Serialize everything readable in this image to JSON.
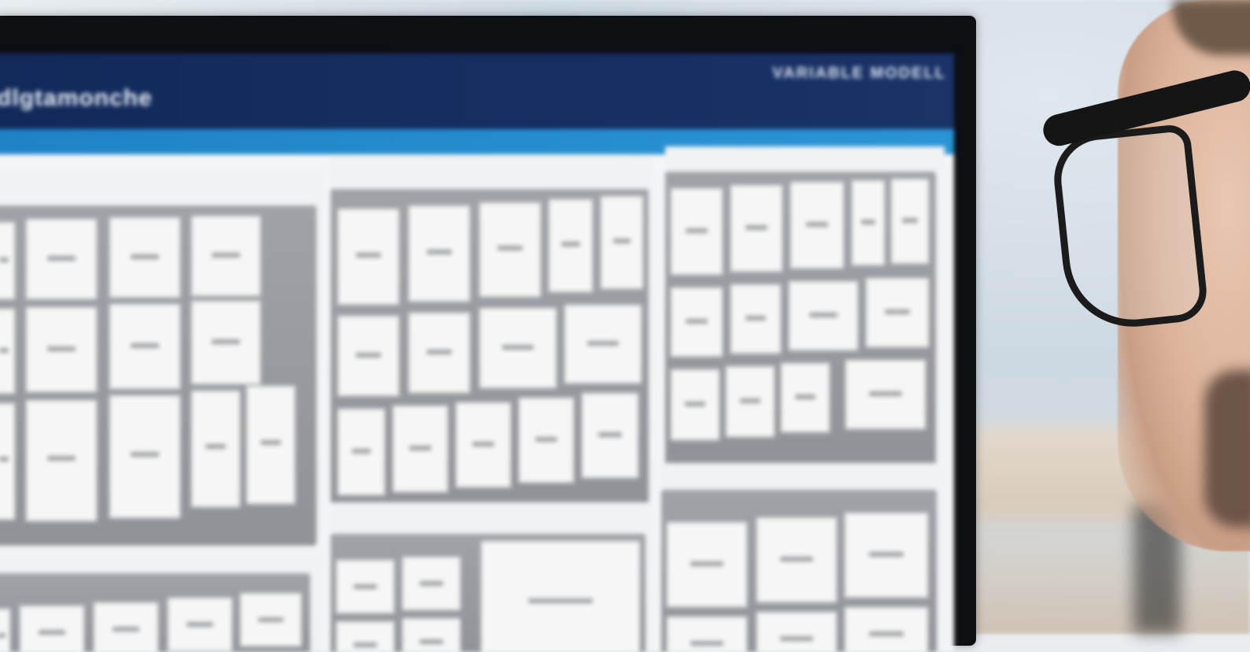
{
  "scene": {
    "description_free": true
  },
  "monitor_app": {
    "title": "dlgtamonche",
    "subtitle": "VARIABLE MODELL",
    "header_color": "#142d5e",
    "band_color": "#2690d0"
  },
  "panels": [
    {
      "label": ""
    },
    {
      "label": ""
    },
    {
      "label": ""
    },
    {
      "label": ""
    },
    {
      "label": ""
    },
    {
      "label": ""
    }
  ]
}
